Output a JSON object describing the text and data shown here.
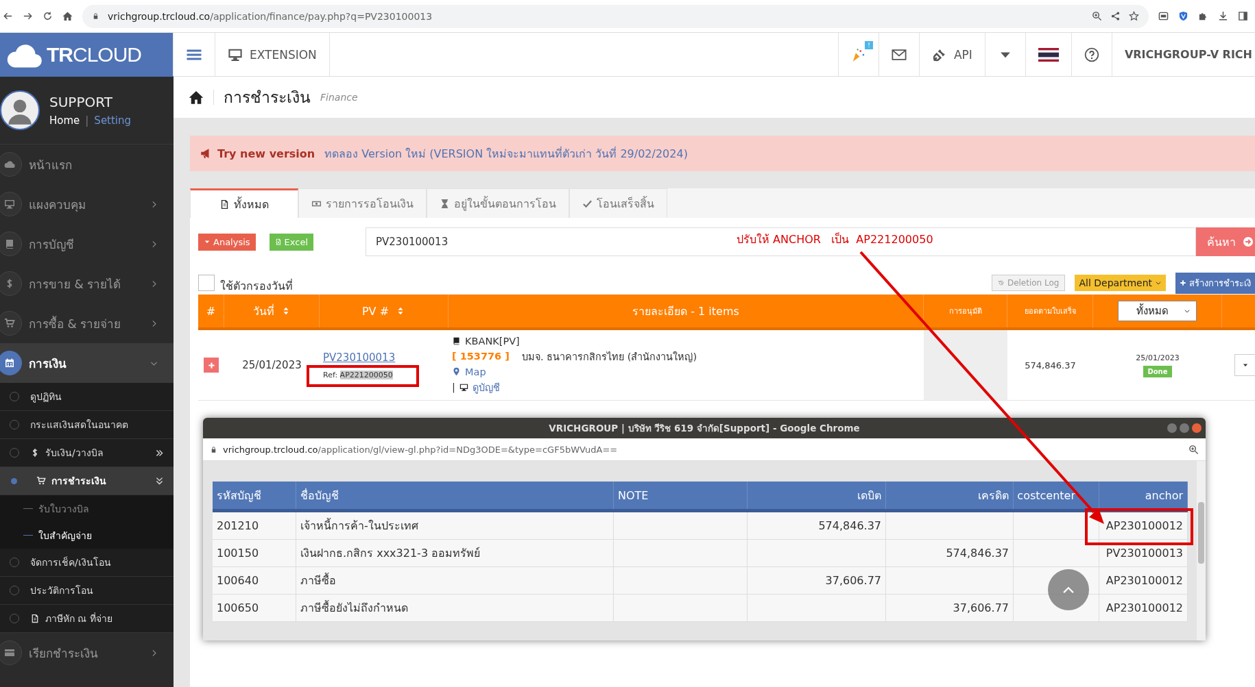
{
  "browser": {
    "url_host": "vrichgroup.trcloud.co",
    "url_path": "/application/finance/pay.php?q=PV230100013"
  },
  "topnav": {
    "logo": "**TR**CLOUD",
    "extension": "EXTENSION",
    "badge": "!",
    "api": "API",
    "user": "VRICHGROUP-V RICH"
  },
  "profile": {
    "name": "SUPPORT",
    "links": [
      {
        "label": "Home"
      },
      {
        "label": "Setting"
      }
    ],
    "separator": "|"
  },
  "sidebar": {
    "items": [
      {
        "label": "หน้าแรก",
        "kind": "link",
        "selected": false
      },
      {
        "label": "แผงควบคุม",
        "kind": "menu",
        "selected": false,
        "expanded": false
      },
      {
        "label": "การบัญชี",
        "kind": "menu",
        "selected": false,
        "expanded": false
      },
      {
        "label": "การขาย & รายได้",
        "kind": "menu",
        "selected": false,
        "expanded": false
      },
      {
        "label": "การซื้อ & รายจ่าย",
        "kind": "menu",
        "selected": false,
        "expanded": false
      },
      {
        "label": "การเงิน",
        "kind": "menu",
        "selected": true,
        "expanded": true,
        "children": [
          {
            "label": "ดูปฏิทิน",
            "kind": "link",
            "selected": false
          },
          {
            "label": "กระแสเงินสดในอนาคต",
            "kind": "link",
            "selected": false
          },
          {
            "label": "รับเงิน/วางบิล",
            "kind": "group",
            "selected": false,
            "expanded": false
          },
          {
            "label": "การชำระเงิน",
            "kind": "group",
            "selected": true,
            "expanded": true,
            "children": [
              {
                "label": "รับใบวางบิล",
                "selected": false
              },
              {
                "label": "ใบสำคัญจ่าย",
                "selected": true
              }
            ]
          },
          {
            "label": "จัดการเช็ค/เงินโอน",
            "kind": "link",
            "selected": false
          },
          {
            "label": "ประวัติการโอน",
            "kind": "link",
            "selected": false
          },
          {
            "label": "ภาษีหัก ณ ที่จ่าย",
            "kind": "link",
            "selected": false
          }
        ]
      },
      {
        "label": "เรียกชำระเงิน",
        "kind": "menu",
        "selected": false,
        "expanded": false
      }
    ]
  },
  "page": {
    "title": "การชำระเงิน",
    "subtitle": "Finance"
  },
  "alert": {
    "label": "Try new version",
    "text": "ทดลอง Version ใหม่ (VERSION ใหม่จะมาแทนที่ตัวเก่า วันที่ 29/02/2024)"
  },
  "tabs": [
    {
      "label": "ทั้งหมด",
      "selected": true
    },
    {
      "label": "รายการรอโอนเงิน",
      "selected": false
    },
    {
      "label": "อยู่ในขั้นตอนการโอน",
      "selected": false
    },
    {
      "label": "โอนเสร็จสิ้น",
      "selected": false
    }
  ],
  "toolbar": {
    "analysis": "Analysis",
    "excel": "Excel",
    "search_value": "PV230100013",
    "search_button": "ค้นหา",
    "note": "ปรับให้ ANCHOR   เป็น  AP221200050"
  },
  "filter": {
    "label": "ใช้ตัวกรองวันที่",
    "checked": false,
    "deletion_log": "Deletion Log",
    "department": "All Department",
    "create": "สร้างการชำระเงิ"
  },
  "table": {
    "columns": [
      {
        "label": "#",
        "kind": "text"
      },
      {
        "label": "วันที่",
        "kind": "sort"
      },
      {
        "label": "PV #",
        "kind": "sort"
      },
      {
        "label": "รายละเอียด - 1 items",
        "kind": "text"
      },
      {
        "label": "การอนุมัติ",
        "kind": "small"
      },
      {
        "label": "ยอดตามใบเสร็จ",
        "kind": "small"
      },
      {
        "label": "ทั้งหมด",
        "kind": "select"
      }
    ],
    "rows": [
      {
        "date": "25/01/2023",
        "pv": "PV230100013",
        "ref_label": "Ref:",
        "ref": "AP221200050",
        "bank": "KBANK[PV]",
        "code": "[ 153776 ]",
        "bank_name": "บมจ. ธนาคารกสิกรไทย (สำนักงานใหญ่)",
        "map": "Map",
        "separator": "|",
        "ledger": "ดูบัญชี",
        "amount": "574,846.37",
        "receipt_date": "25/01/2023",
        "status": "Done"
      }
    ]
  },
  "popup": {
    "title": "VRICHGROUP | บริษัท วีริช 619 จำกัด[Support] - Google Chrome",
    "url_host": "vrichgroup.trcloud.co",
    "url_path": "/application/gl/view-gl.php?id=NDg3ODE=&type=cGF5bWVudA==",
    "columns": [
      {
        "label": "รหัสบัญชี",
        "kind": "text"
      },
      {
        "label": "ชื่อบัญชี",
        "kind": "text"
      },
      {
        "label": "NOTE",
        "kind": "text"
      },
      {
        "label": "เดบิต",
        "kind": "number"
      },
      {
        "label": "เครดิต",
        "kind": "number"
      },
      {
        "label": "costcenter",
        "kind": "number"
      },
      {
        "label": "anchor",
        "kind": "number"
      }
    ],
    "rows": [
      [
        "201210",
        "เจ้าหนี้การค้า-ในประเทศ",
        "",
        "574,846.37",
        "",
        "",
        "AP230100012"
      ],
      [
        "100150",
        "เงินฝากธ.กสิกร xxx321-3 ออมทรัพย์",
        "",
        "",
        "574,846.37",
        "",
        "PV230100013"
      ],
      [
        "100640",
        "ภาษีซื้อ",
        "",
        "37,606.77",
        "",
        "",
        "AP230100012"
      ],
      [
        "100650",
        "ภาษีซื้อยังไม่ถึงกำหนด",
        "",
        "",
        "37,606.77",
        "",
        "AP230100012"
      ]
    ]
  }
}
